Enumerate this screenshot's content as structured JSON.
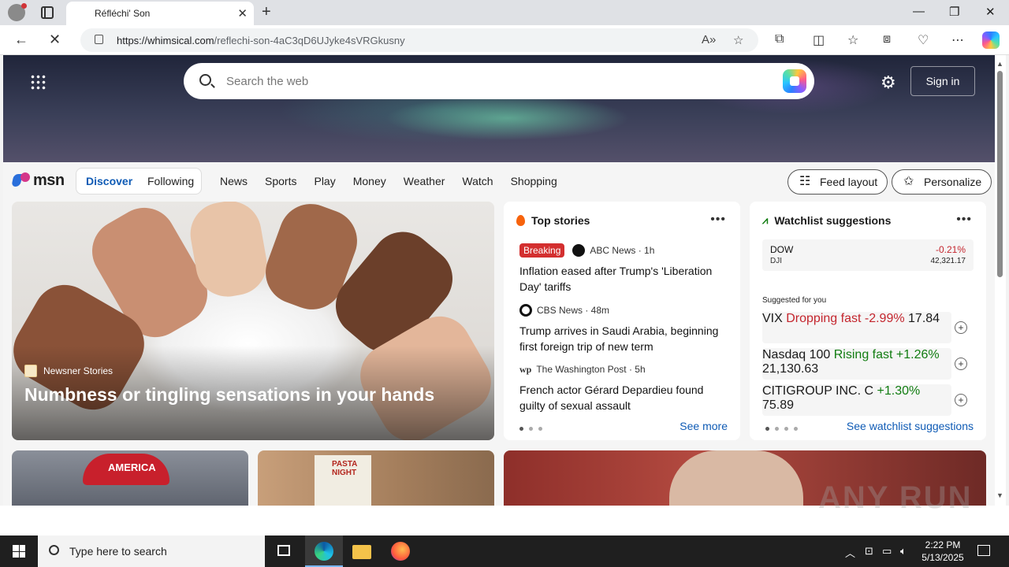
{
  "browser": {
    "tab_title": "Réfléchi' Son",
    "url_host": "https://whimsical.com",
    "url_path": "/reflechi-son-4aC3qD6UJyke4sVRGkusny"
  },
  "header": {
    "search_placeholder": "Search the web",
    "signin_label": "Sign in"
  },
  "msn": {
    "logo_text": "msn",
    "feed_tabs": [
      "Discover",
      "Following"
    ],
    "nav": [
      "News",
      "Sports",
      "Play",
      "Money",
      "Weather",
      "Watch",
      "Shopping"
    ],
    "feed_layout_label": "Feed layout",
    "personalize_label": "Personalize"
  },
  "main_story": {
    "source": "Newsner Stories",
    "headline": "Numbness or tingling sensations in your hands"
  },
  "top_stories": {
    "title": "Top stories",
    "items": [
      {
        "badge": "Breaking",
        "source": "ABC News · 1h",
        "title": "Inflation eased after Trump's 'Liberation Day' tariffs"
      },
      {
        "source": "CBS News · 48m",
        "title": "Trump arrives in Saudi Arabia, beginning first foreign trip of new term"
      },
      {
        "source": "The Washington Post · 5h",
        "title": "French actor Gérard Depardieu found guilty of sexual assault"
      }
    ],
    "see_more": "See more"
  },
  "watchlist": {
    "title": "Watchlist suggestions",
    "dow": {
      "symbol": "DOW",
      "sub": "DJI",
      "change": "-0.21%",
      "value": "42,321.17"
    },
    "suggested_label": "Suggested for you",
    "suggestions": [
      {
        "symbol": "VIX",
        "sub": "Dropping fast",
        "change": "-2.99%",
        "value": "17.84"
      },
      {
        "symbol": "Nasdaq 100",
        "sub": "Rising fast",
        "change": "+1.26%",
        "value": "21,130.63"
      },
      {
        "symbol": "CITIGROUP INC.",
        "sub": "C",
        "change": "+1.30%",
        "value": "75.89"
      }
    ],
    "see_all": "See watchlist suggestions"
  },
  "taskbar": {
    "search_text": "Type here to search",
    "time": "2:22 PM",
    "date": "5/13/2025"
  },
  "watermark": "ANY RUN",
  "colors": {
    "accent": "#0f5bb5",
    "negative": "#c4262e",
    "positive": "#107c10",
    "breaking": "#d32f2f"
  }
}
